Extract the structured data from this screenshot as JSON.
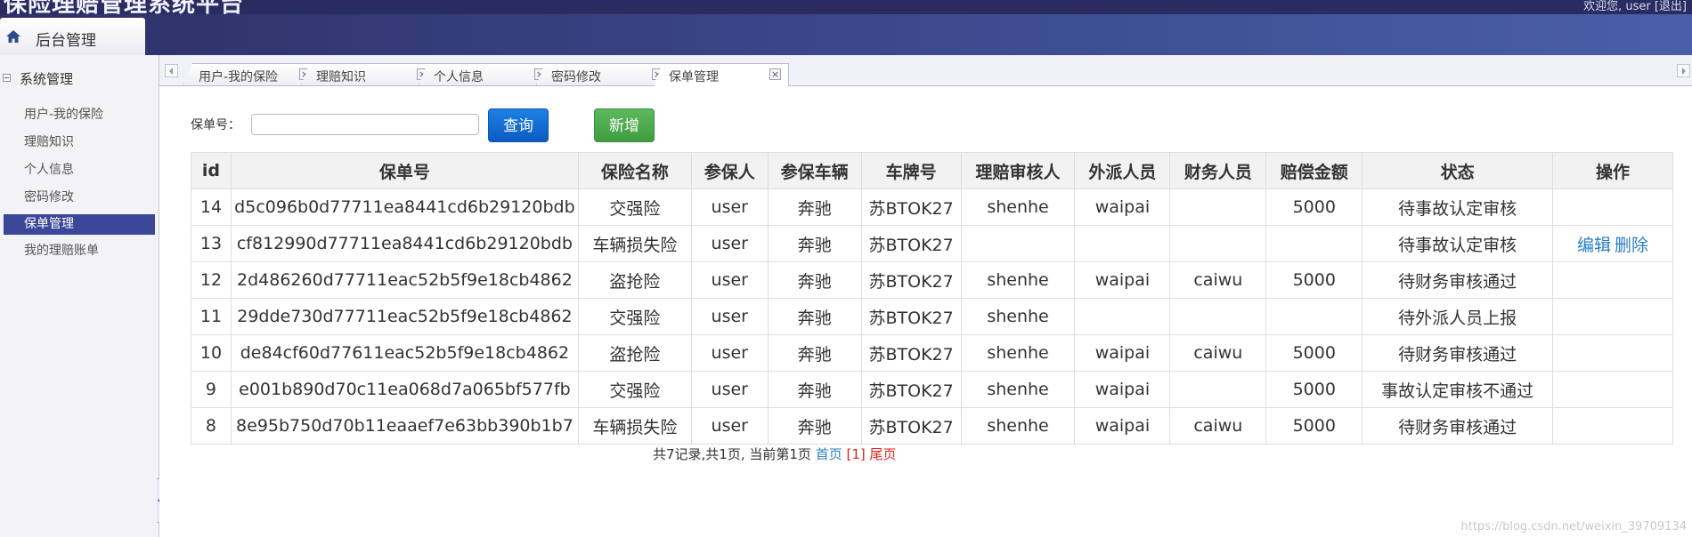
{
  "header": {
    "system_title": "保险理赔管理系统平台",
    "welcome_text": "欢迎您, user [退出]",
    "home_tab_label": "后台管理"
  },
  "sidebar": {
    "group_label": "系统管理",
    "items": [
      {
        "label": "用户-我的保险"
      },
      {
        "label": "理赔知识"
      },
      {
        "label": "个人信息"
      },
      {
        "label": "密码修改"
      },
      {
        "label": "保单管理",
        "active": true
      },
      {
        "label": "我的理赔账单"
      }
    ]
  },
  "tabs": [
    {
      "label": "用户-我的保险"
    },
    {
      "label": "理赔知识"
    },
    {
      "label": "个人信息"
    },
    {
      "label": "密码修改"
    },
    {
      "label": "保单管理",
      "active": true
    }
  ],
  "tab_close_glyph": "×",
  "search": {
    "label": "保单号：",
    "value": "",
    "placeholder": "",
    "query_label": "查询",
    "add_label": "新增"
  },
  "table": {
    "columns": [
      "id",
      "保单号",
      "保险名称",
      "参保人",
      "参保车辆",
      "车牌号",
      "理赔审核人",
      "外派人员",
      "财务人员",
      "赔偿金额",
      "状态",
      "操作"
    ],
    "rows": [
      {
        "id": "14",
        "policy_no": "d5c096b0d77711ea8441cd6b29120bdb",
        "insurance": "交强险",
        "insured": "user",
        "vehicle": "奔驰",
        "plate": "苏BTOK27",
        "reviewer": "shenhe",
        "dispatcher": "waipai",
        "finance": "",
        "amount": "5000",
        "status": "待事故认定审核",
        "ops": []
      },
      {
        "id": "13",
        "policy_no": "cf812990d77711ea8441cd6b29120bdb",
        "insurance": "车辆损失险",
        "insured": "user",
        "vehicle": "奔驰",
        "plate": "苏BTOK27",
        "reviewer": "",
        "dispatcher": "",
        "finance": "",
        "amount": "",
        "status": "待事故认定审核",
        "ops": [
          "编辑",
          "删除"
        ]
      },
      {
        "id": "12",
        "policy_no": "2d486260d77711eac52b5f9e18cb4862",
        "insurance": "盗抢险",
        "insured": "user",
        "vehicle": "奔驰",
        "plate": "苏BTOK27",
        "reviewer": "shenhe",
        "dispatcher": "waipai",
        "finance": "caiwu",
        "amount": "5000",
        "status": "待财务审核通过",
        "ops": []
      },
      {
        "id": "11",
        "policy_no": "29dde730d77711eac52b5f9e18cb4862",
        "insurance": "交强险",
        "insured": "user",
        "vehicle": "奔驰",
        "plate": "苏BTOK27",
        "reviewer": "shenhe",
        "dispatcher": "",
        "finance": "",
        "amount": "",
        "status": "待外派人员上报",
        "ops": []
      },
      {
        "id": "10",
        "policy_no": "de84cf60d77611eac52b5f9e18cb4862",
        "insurance": "盗抢险",
        "insured": "user",
        "vehicle": "奔驰",
        "plate": "苏BTOK27",
        "reviewer": "shenhe",
        "dispatcher": "waipai",
        "finance": "caiwu",
        "amount": "5000",
        "status": "待财务审核通过",
        "ops": []
      },
      {
        "id": "9",
        "policy_no": "e001b890d70c11ea068d7a065bf577fb",
        "insurance": "交强险",
        "insured": "user",
        "vehicle": "奔驰",
        "plate": "苏BTOK27",
        "reviewer": "shenhe",
        "dispatcher": "waipai",
        "finance": "",
        "amount": "5000",
        "status": "事故认定审核不通过",
        "ops": []
      },
      {
        "id": "8",
        "policy_no": "8e95b750d70b11eaaef7e63bb390b1b7",
        "insurance": "车辆损失险",
        "insured": "user",
        "vehicle": "奔驰",
        "plate": "苏BTOK27",
        "reviewer": "shenhe",
        "dispatcher": "waipai",
        "finance": "caiwu",
        "amount": "5000",
        "status": "待财务审核通过",
        "ops": []
      }
    ]
  },
  "pager": {
    "summary": "共7记录,共1页, 当前第1页 ",
    "first_label": "首页",
    "current_label": " [1] ",
    "last_label": "尾页"
  },
  "watermark": "https://blog.csdn.net/weixin_39709134",
  "colors": {
    "header_dark": "#2e2f66",
    "active_menu": "#3b4799",
    "query_button": "#0c5bc2",
    "add_button": "#3f9d3f",
    "link": "#2a7ec4",
    "current_page": "#e0241c"
  }
}
